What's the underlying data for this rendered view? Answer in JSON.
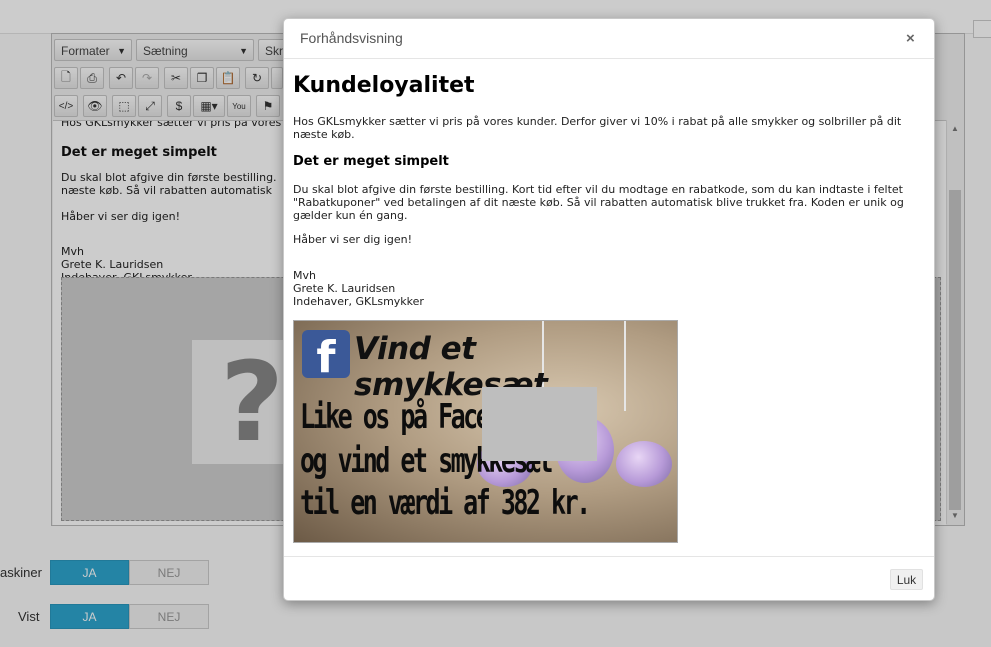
{
  "editor": {
    "toolbar": {
      "format_label": "Formater",
      "sentence_label": "Sætning",
      "font_label": "Skri"
    },
    "content": {
      "line1": "Hos GKLsmykker sætter vi pris på vores",
      "heading": "Det er meget simpelt",
      "line2": "Du skal blot afgive din første bestilling.",
      "line3": "næste køb. Så vil rabatten automatisk",
      "line4": "Håber vi ser dig igen!",
      "sign1": "Mvh",
      "sign2": "Grete K. Lauridsen",
      "sign3_prefix": "Indehaver, ",
      "sign3_word": "GKLsmykker",
      "placeholder_glyph": "?"
    }
  },
  "settings": {
    "row1_label": "askiner",
    "row2_label": "Vist",
    "yes_label": "JA",
    "no_label": "NEJ"
  },
  "modal": {
    "title": "Forhåndsvisning",
    "close_glyph": "×",
    "heading": "Kundeloyalitet",
    "para1": "Hos GKLsmykker sætter vi pris på vores kunder. Derfor giver vi 10% i rabat på alle smykker og solbriller på dit næste køb.",
    "subheading": "Det er meget simpelt",
    "para2": "Du skal blot afgive din første bestilling. Kort tid efter vil du modtage en rabatkode, som du kan indtaste i feltet \"Rabatkuponer\" ved betalingen af dit næste køb. Så vil rabatten automatisk blive trukket fra. Koden er unik og gælder kun én gang.",
    "para3": "Håber vi ser dig igen!",
    "sign1": "Mvh",
    "sign2": "Grete K. Lauridsen",
    "sign3": "Indehaver, GKLsmykker",
    "banner": {
      "fb_glyph": "f",
      "title": "Vind et smykkesæt",
      "line1": "Like os på Facebook",
      "line2": "og vind et smykkesæt",
      "line3": "til en værdi af 382 kr."
    },
    "close_button": "Luk"
  }
}
